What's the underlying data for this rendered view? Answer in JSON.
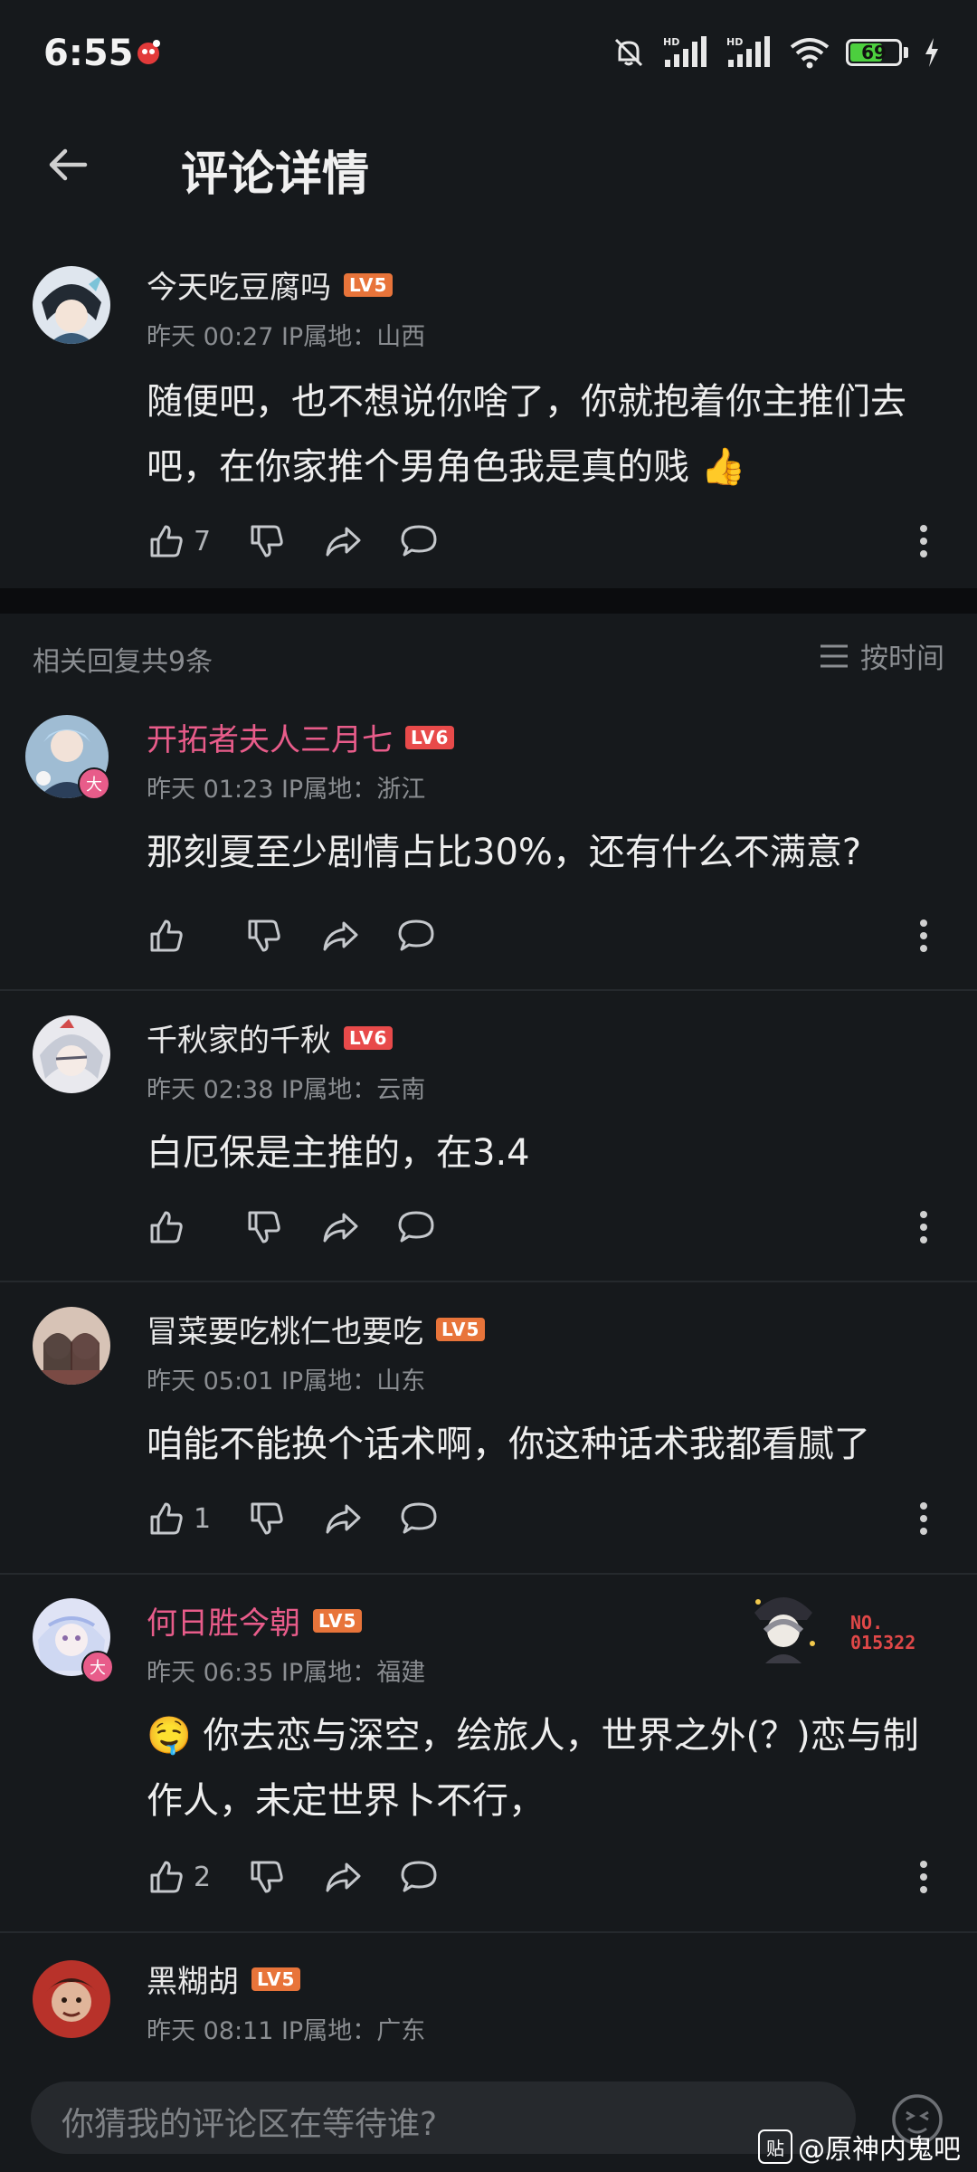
{
  "status_bar": {
    "time": "6:55",
    "battery": "69",
    "battery_fraction": 0.69,
    "network_labels": [
      "HD",
      "HD"
    ]
  },
  "header": {
    "title": "评论详情"
  },
  "main_comment": {
    "username": "今天吃豆腐吗",
    "level": "LV5",
    "meta": "昨天 00:27 IP属地：山西",
    "content": "随便吧，也不想说你啥了，你就抱着你主推们去吧，在你家推个男角色我是真的贱",
    "emoji": "👍",
    "likes": "7"
  },
  "replies_header": {
    "count_label": "相关回复共9条",
    "sort_label": "按时间"
  },
  "replies": [
    {
      "username": "开拓者夫人三月七",
      "level": "LV6",
      "meta": "昨天 01:23 IP属地：浙江",
      "content": "那刻夏至少剧情占比30%，还有什么不满意?",
      "likes": "",
      "badge": "大"
    },
    {
      "username": "千秋家的千秋",
      "level": "LV6",
      "meta": "昨天 02:38 IP属地：云南",
      "content": "白厄保是主推的，在3.4",
      "likes": ""
    },
    {
      "username": "冒菜要吃桃仁也要吃",
      "level": "LV5",
      "meta": "昨天 05:01 IP属地：山东",
      "content": "咱能不能换个话术啊，你这种话术我都看腻了",
      "likes": "1"
    },
    {
      "username": "何日胜今朝",
      "level": "LV5",
      "meta": "昨天 06:35 IP属地：福建",
      "content_emoji": "🤤",
      "content": "你去恋与深空，绘旅人，世界之外(？)恋与制作人，未定世界卜不行，",
      "likes": "2",
      "badge": "大",
      "medal_label": "NO.",
      "medal_number": "015322"
    },
    {
      "username": "黑糊胡",
      "level": "LV5",
      "meta": "昨天 08:11 IP属地：广东"
    }
  ],
  "input": {
    "placeholder": "你猜我的评论区在等待谁?"
  },
  "watermark": {
    "logo": "贴",
    "text": "@原神内鬼吧"
  },
  "colors": {
    "background": "#16191c",
    "pink_username": "#e85c8a",
    "level_orange": "#e8743a",
    "level_red": "#e84a4a",
    "meta_gray": "#8a8d91"
  },
  "icons": [
    "back-arrow-icon",
    "like-icon",
    "dislike-icon",
    "share-icon",
    "comment-icon",
    "more-icon",
    "sort-list-icon",
    "emoji-icon"
  ]
}
